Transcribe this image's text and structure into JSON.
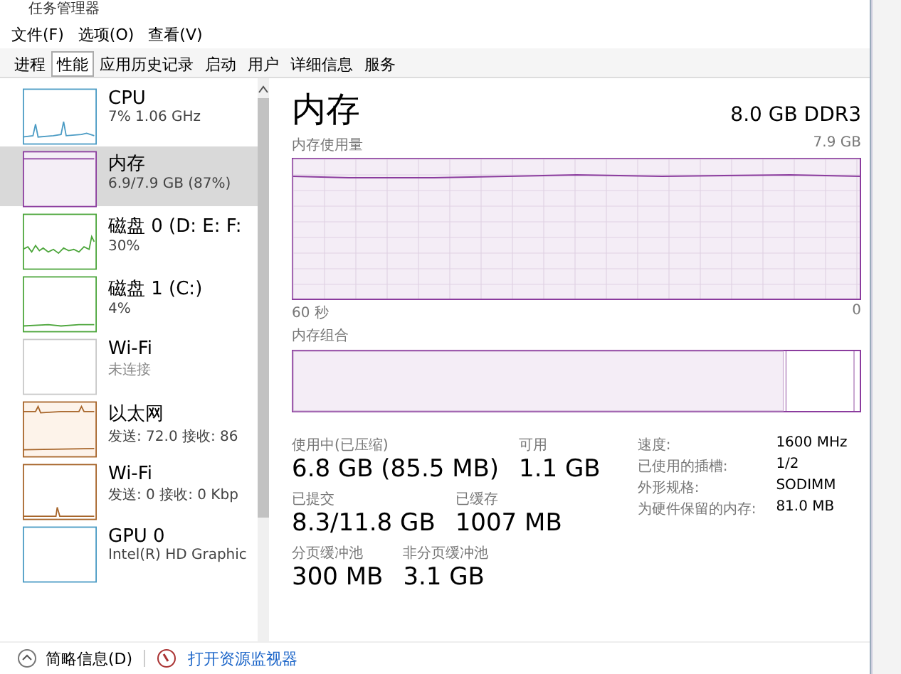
{
  "window": {
    "title": "任务管理器"
  },
  "menu": [
    "文件(F)",
    "选项(O)",
    "查看(V)"
  ],
  "tabs": [
    {
      "label": "进程",
      "selected": false
    },
    {
      "label": "性能",
      "selected": true
    },
    {
      "label": "应用历史记录",
      "selected": false
    },
    {
      "label": "启动",
      "selected": false
    },
    {
      "label": "用户",
      "selected": false
    },
    {
      "label": "详细信息",
      "selected": false
    },
    {
      "label": "服务",
      "selected": false
    }
  ],
  "sidebar": {
    "items": [
      {
        "name": "CPU",
        "detail": "7% 1.06 GHz",
        "kind": "spiky",
        "color": "#4a9bc4",
        "selected": false
      },
      {
        "name": "内存",
        "detail": "6.9/7.9 GB (87%)",
        "kind": "full",
        "color": "#8b3c9e",
        "selected": true
      },
      {
        "name": "磁盘 0 (D: E: F:",
        "detail": "30%",
        "kind": "noisy",
        "color": "#4da63c",
        "selected": false
      },
      {
        "name": "磁盘 1 (C:)",
        "detail": "4%",
        "kind": "low",
        "color": "#4da63c",
        "selected": false
      },
      {
        "name": "Wi-Fi",
        "detail": "未连接",
        "kind": "empty",
        "color": "#c8c8c8",
        "selected": false
      },
      {
        "name": "以太网",
        "detail": "发送: 72.0 接收: 86",
        "kind": "net",
        "color": "#a7652a",
        "selected": false
      },
      {
        "name": "Wi-Fi",
        "detail": "发送: 0 接收: 0 Kbp",
        "kind": "blip",
        "color": "#a7652a",
        "selected": false
      },
      {
        "name": "GPU 0",
        "detail": "Intel(R) HD Graphic",
        "kind": "empty",
        "color": "#4a9bc4",
        "selected": false
      }
    ]
  },
  "panel": {
    "title": "内存",
    "subtitle": "8.0 GB DDR3",
    "usage_chart": {
      "label": "内存使用量",
      "max": "7.9 GB",
      "x_start": "60 秒",
      "x_end": "0"
    },
    "composition": {
      "label": "内存组合",
      "level": 0.865
    },
    "stats": [
      [
        {
          "label": "使用中(已压缩)",
          "value": "6.8 GB (85.5 MB)"
        },
        {
          "label": "可用",
          "value": "1.1 GB"
        }
      ],
      [
        {
          "label": "已提交",
          "value": "8.3/11.8 GB"
        },
        {
          "label": "已缓存",
          "value": "1007 MB"
        }
      ],
      [
        {
          "label": "分页缓冲池",
          "value": "300 MB"
        },
        {
          "label": "非分页缓冲池",
          "value": "3.1 GB"
        }
      ]
    ],
    "details": [
      {
        "key": "速度:",
        "value": "1600 MHz"
      },
      {
        "key": "已使用的插槽:",
        "value": "1/2"
      },
      {
        "key": "外形规格:",
        "value": "SODIMM"
      },
      {
        "key": "为硬件保留的内存:",
        "value": "81.0 MB"
      }
    ]
  },
  "footer": {
    "summary_button": "简略信息(D)",
    "monitor_link": "打开资源监视器"
  }
}
